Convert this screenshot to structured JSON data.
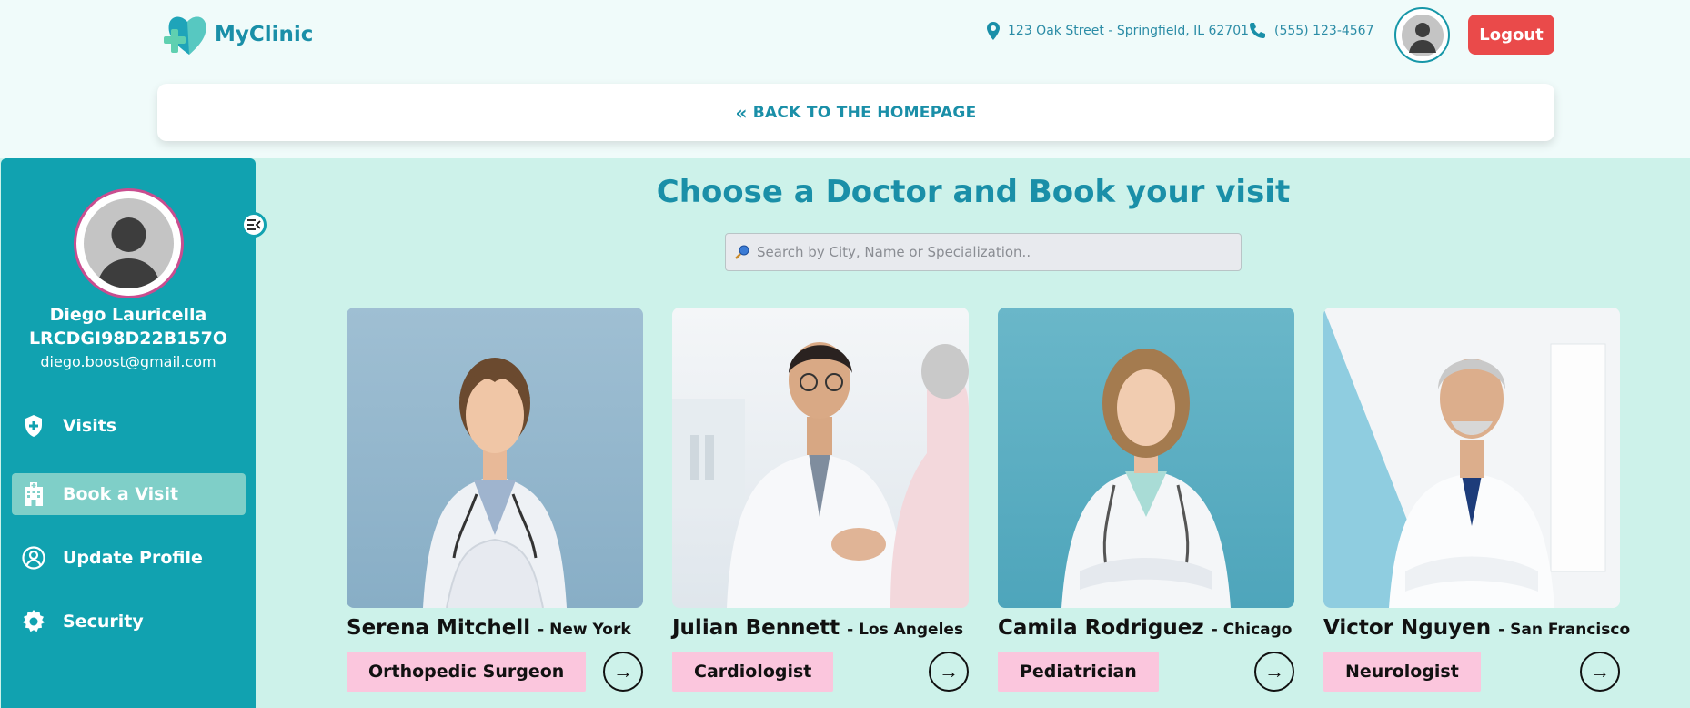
{
  "header": {
    "brand": "MyClinic",
    "address": "123 Oak Street - Springfield, IL 62701",
    "phone": "(555) 123-4567",
    "logout_label": "Logout"
  },
  "back_link": "BACK TO THE HOMEPAGE",
  "sidebar": {
    "user_name": "Diego Lauricella",
    "user_code": "LRCDGI98D22B157O",
    "user_email": "diego.boost@gmail.com",
    "items": [
      {
        "label": "Visits",
        "icon": "shield-plus-icon",
        "active": false
      },
      {
        "label": "Book a Visit",
        "icon": "hospital-icon",
        "active": true
      },
      {
        "label": "Update Profile",
        "icon": "user-circle-icon",
        "active": false
      },
      {
        "label": "Security",
        "icon": "gear-icon",
        "active": false
      }
    ]
  },
  "main": {
    "title": "Choose a Doctor and Book your visit",
    "search_placeholder": "Search by City, Name or Specialization..",
    "doctors": [
      {
        "name": "Serena Mitchell",
        "city": "New York",
        "specialization": "Orthopedic Surgeon"
      },
      {
        "name": "Julian Bennett",
        "city": "Los Angeles",
        "specialization": "Cardiologist"
      },
      {
        "name": "Camila Rodriguez",
        "city": "Chicago",
        "specialization": "Pediatrician"
      },
      {
        "name": "Victor Nguyen",
        "city": "San Francisco",
        "specialization": "Neurologist"
      }
    ]
  },
  "colors": {
    "brand": "#1a8fa8",
    "sidebar": "#11a2b0",
    "active_item": "#7fcfc8",
    "logout": "#ea4a4a",
    "spec_badge": "#fbc6dd",
    "main_bg": "#cdf2ea"
  }
}
